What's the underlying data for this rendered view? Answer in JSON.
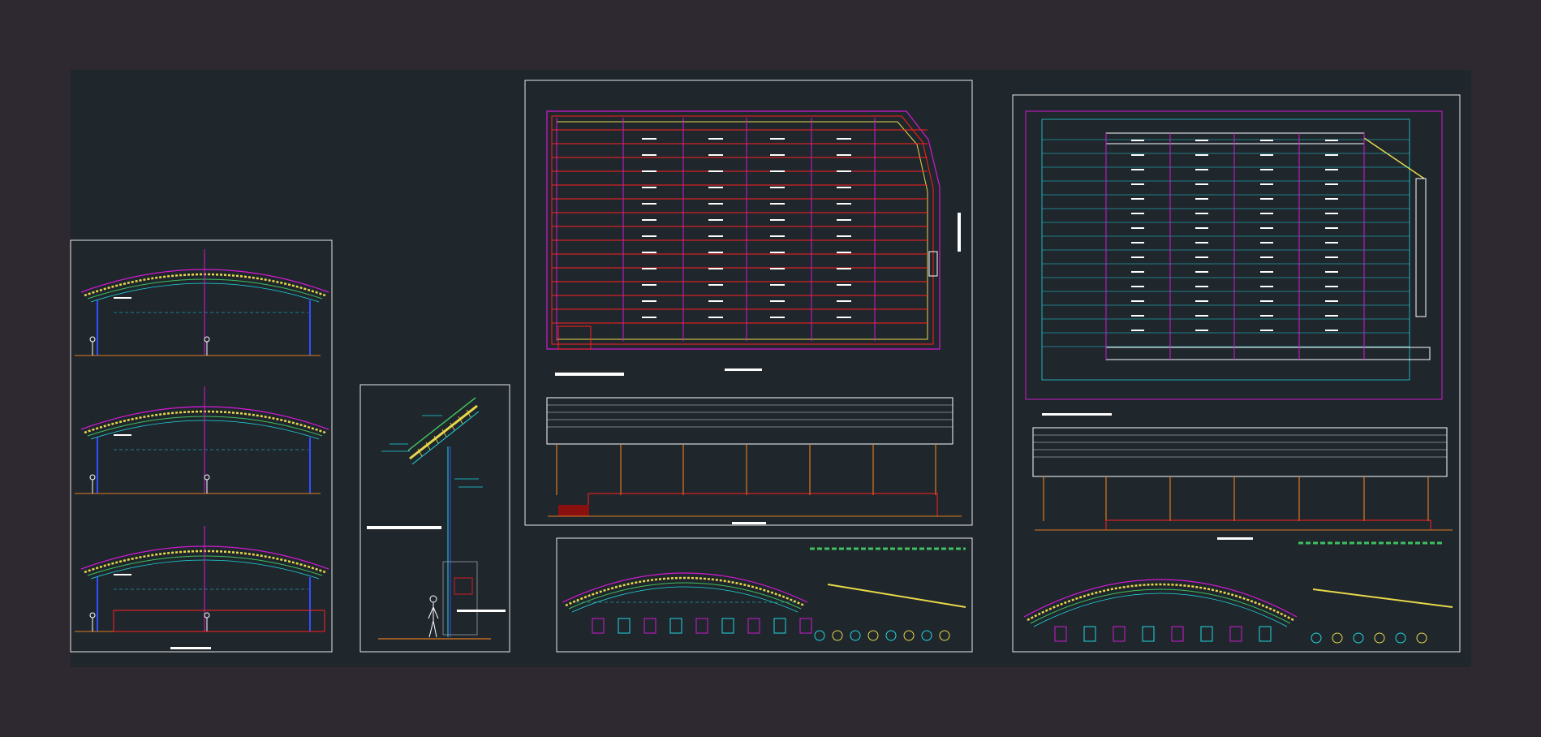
{
  "drawing": {
    "colors": {
      "outer_bg": "#2e2830",
      "model_bg": "#1f262c",
      "frame": "#e8e8e8",
      "magenta": "#d21ad2",
      "red": "#ff2020",
      "yellow": "#e8d84a",
      "orange": "#e07a20",
      "cyan": "#20d8e0",
      "green": "#40c060",
      "blue": "#3050ff",
      "white": "#ffffff",
      "gray": "#9aa0a6"
    },
    "sheets": [
      {
        "id": "arch-sections",
        "label": ""
      },
      {
        "id": "wall-section-detail",
        "label": ""
      },
      {
        "id": "roof-plan-a",
        "label": ""
      },
      {
        "id": "arch-details-a",
        "label": ""
      },
      {
        "id": "roof-plan-b",
        "label": ""
      }
    ]
  }
}
